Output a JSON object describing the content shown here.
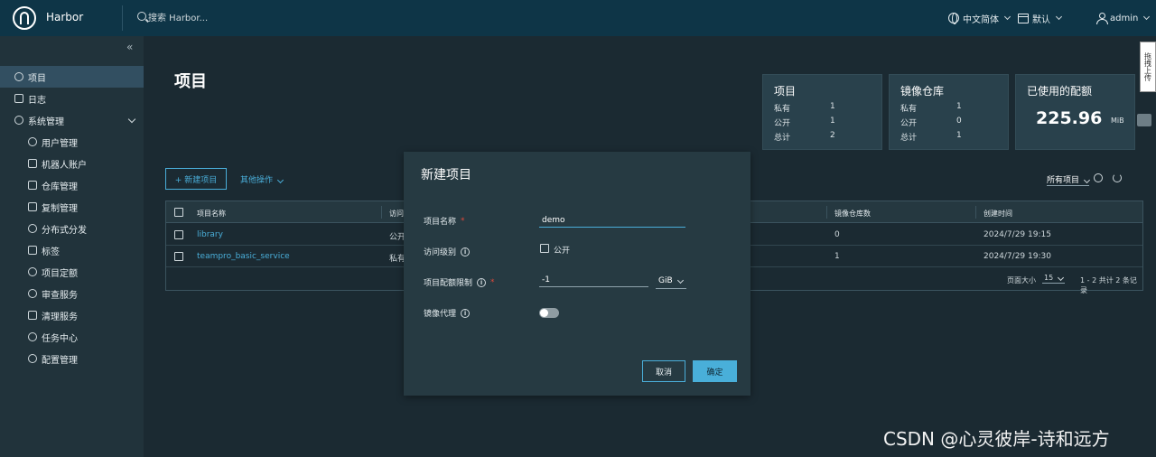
{
  "header": {
    "brand": "Harbor",
    "search_placeholder": "搜索 Harbor...",
    "language": "中文简体",
    "datetime_format": "默认",
    "user": "admin"
  },
  "sidebar": {
    "collapse_glyph": "«",
    "items": [
      {
        "label": "项目",
        "icon": "projects-icon",
        "active": true
      },
      {
        "label": "日志",
        "icon": "logs-icon"
      },
      {
        "label": "系统管理",
        "icon": "admin-icon",
        "expanded": true
      },
      {
        "label": "用户管理",
        "icon": "users-icon"
      },
      {
        "label": "机器人账户",
        "icon": "robot-icon"
      },
      {
        "label": "仓库管理",
        "icon": "registry-icon"
      },
      {
        "label": "复制管理",
        "icon": "replication-icon"
      },
      {
        "label": "分布式分发",
        "icon": "distribution-icon"
      },
      {
        "label": "标签",
        "icon": "tag-icon"
      },
      {
        "label": "项目定额",
        "icon": "quota-icon"
      },
      {
        "label": "审查服务",
        "icon": "scanner-icon"
      },
      {
        "label": "清理服务",
        "icon": "cleanup-icon"
      },
      {
        "label": "任务中心",
        "icon": "jobs-icon"
      },
      {
        "label": "配置管理",
        "icon": "config-icon"
      }
    ]
  },
  "main": {
    "title": "项目",
    "stats": {
      "projects": {
        "title": "项目",
        "rows": [
          {
            "k": "私有",
            "v": "1"
          },
          {
            "k": "公开",
            "v": "1"
          },
          {
            "k": "总计",
            "v": "2"
          }
        ]
      },
      "repos": {
        "title": "镜像仓库",
        "rows": [
          {
            "k": "私有",
            "v": "1"
          },
          {
            "k": "公开",
            "v": "0"
          },
          {
            "k": "总计",
            "v": "1"
          }
        ]
      },
      "quota": {
        "title": "已使用的配额",
        "value": "225.96",
        "unit": "MiB"
      }
    },
    "new_project_button": "+ 新建项目",
    "more_actions": "其他操作",
    "filter": "所有项目",
    "table": {
      "headers": [
        "项目名称",
        "访问级别",
        "镜像仓库数",
        "创建时间"
      ],
      "rows": [
        {
          "name": "library",
          "access": "公开",
          "repos": "0",
          "created": "2024/7/29 19:15"
        },
        {
          "name": "teampro_basic_service",
          "access": "私有",
          "repos": "1",
          "created": "2024/7/29 19:30"
        }
      ],
      "page_size_label": "页面大小",
      "page_size": "15",
      "summary": "1 - 2 共计 2 条记录"
    }
  },
  "modal": {
    "title": "新建项目",
    "name_label": "项目名称",
    "name_value": "demo",
    "access_label": "访问级别",
    "public_label": "公开",
    "quota_label": "项目配额限制",
    "quota_value": "-1",
    "quota_unit": "GiB",
    "proxy_label": "镜像代理",
    "cancel": "取消",
    "ok": "确定"
  },
  "side_tab": "拖拽上传",
  "watermark": "CSDN @心灵彼岸-诗和远方",
  "colors": {
    "header": "#0e3547",
    "accent": "#49afd9",
    "sidebar": "#21333b",
    "background": "#1b2a32"
  }
}
